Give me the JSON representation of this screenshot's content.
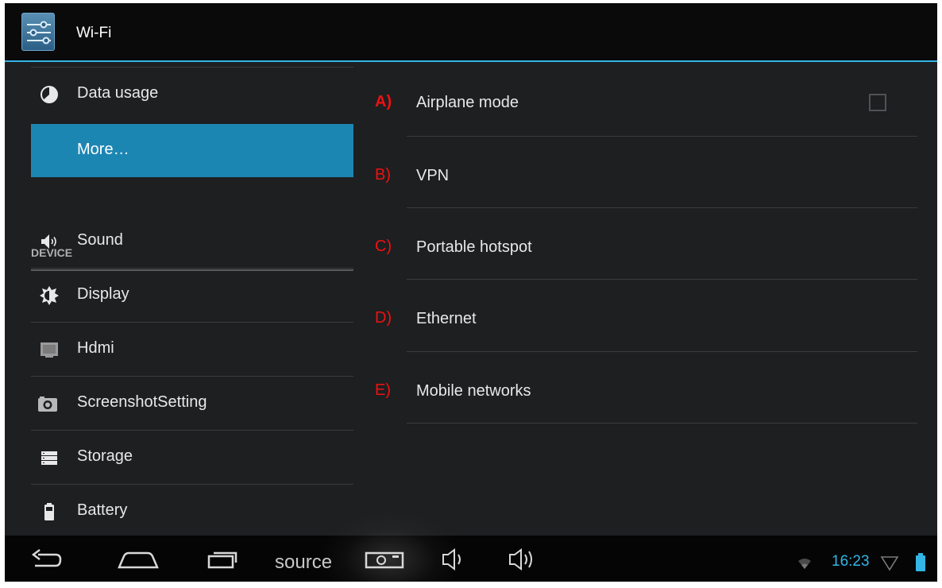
{
  "action_bar": {
    "title": "Wi-Fi",
    "icon": "settings-sliders-icon"
  },
  "sidebar": {
    "items_top": [
      {
        "label": "Data usage",
        "icon": "data-usage-pie-icon"
      },
      {
        "label": "More…",
        "icon": "",
        "selected": true
      }
    ],
    "device_header": "DEVICE",
    "items_device": [
      {
        "label": "Sound",
        "icon": "speaker-icon"
      },
      {
        "label": "Display",
        "icon": "brightness-icon"
      },
      {
        "label": "Hdmi",
        "icon": "hdmi-screen-icon"
      },
      {
        "label": "ScreenshotSetting",
        "icon": "camera-icon"
      },
      {
        "label": "Storage",
        "icon": "storage-icon"
      },
      {
        "label": "Battery",
        "icon": "battery-icon"
      }
    ]
  },
  "main": {
    "items": [
      {
        "letter": "A)",
        "label": "Airplane mode",
        "checkbox": true,
        "checked": false
      },
      {
        "letter": "B)",
        "label": "VPN"
      },
      {
        "letter": "C)",
        "label": "Portable hotspot"
      },
      {
        "letter": "D)",
        "label": "Ethernet"
      },
      {
        "letter": "E)",
        "label": "Mobile networks"
      }
    ]
  },
  "nav_bar": {
    "buttons": [
      "back-icon",
      "home-icon",
      "recent-apps-icon",
      "screenshot-icon",
      "volume-down-icon",
      "volume-up-icon"
    ],
    "source_label": "source",
    "status": {
      "time": "16:23",
      "icons": [
        "wifi-icon",
        "signal-icon",
        "battery-status-icon"
      ]
    }
  },
  "colors": {
    "accent": "#33b5e5",
    "selected_item": "#1c86b3",
    "annotation_red": "#ee1111",
    "background": "#1e1f21"
  }
}
